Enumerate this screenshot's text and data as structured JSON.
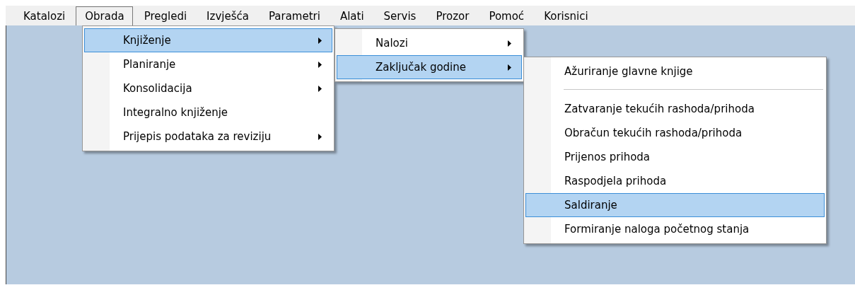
{
  "menubar": [
    {
      "label": "Katalozi",
      "selected": false
    },
    {
      "label": "Obrada",
      "selected": true
    },
    {
      "label": "Pregledi",
      "selected": false
    },
    {
      "label": "Izvješća",
      "selected": false
    },
    {
      "label": "Parametri",
      "selected": false
    },
    {
      "label": "Alati",
      "selected": false
    },
    {
      "label": "Servis",
      "selected": false
    },
    {
      "label": "Prozor",
      "selected": false
    },
    {
      "label": "Pomoć",
      "selected": false
    },
    {
      "label": "Korisnici",
      "selected": false
    }
  ],
  "menus": [
    {
      "items": [
        {
          "kind": "item",
          "label": "Knjiženje",
          "submenu": true,
          "selected": true
        },
        {
          "kind": "item",
          "label": "Planiranje",
          "submenu": true,
          "selected": false
        },
        {
          "kind": "item",
          "label": "Konsolidacija",
          "submenu": true,
          "selected": false
        },
        {
          "kind": "item",
          "label": "Integralno knjiženje",
          "submenu": false,
          "selected": false
        },
        {
          "kind": "item",
          "label": "Prijepis podataka za reviziju",
          "submenu": true,
          "selected": false
        }
      ]
    },
    {
      "items": [
        {
          "kind": "item",
          "label": "Nalozi",
          "submenu": true,
          "selected": false
        },
        {
          "kind": "item",
          "label": "Zaključak godine",
          "submenu": true,
          "selected": true
        }
      ]
    },
    {
      "items": [
        {
          "kind": "item",
          "label": "Ažuriranje glavne knjige",
          "submenu": false,
          "selected": false
        },
        {
          "kind": "separator"
        },
        {
          "kind": "item",
          "label": "Zatvaranje tekućih rashoda/prihoda",
          "submenu": false,
          "selected": false
        },
        {
          "kind": "item",
          "label": "Obračun tekućih rashoda/prihoda",
          "submenu": false,
          "selected": false
        },
        {
          "kind": "item",
          "label": "Prijenos prihoda",
          "submenu": false,
          "selected": false
        },
        {
          "kind": "item",
          "label": "Raspodjela prihoda",
          "submenu": false,
          "selected": false
        },
        {
          "kind": "item",
          "label": "Saldiranje",
          "submenu": false,
          "selected": true
        },
        {
          "kind": "item",
          "label": "Formiranje naloga početnog stanja",
          "submenu": false,
          "selected": false
        }
      ]
    }
  ]
}
